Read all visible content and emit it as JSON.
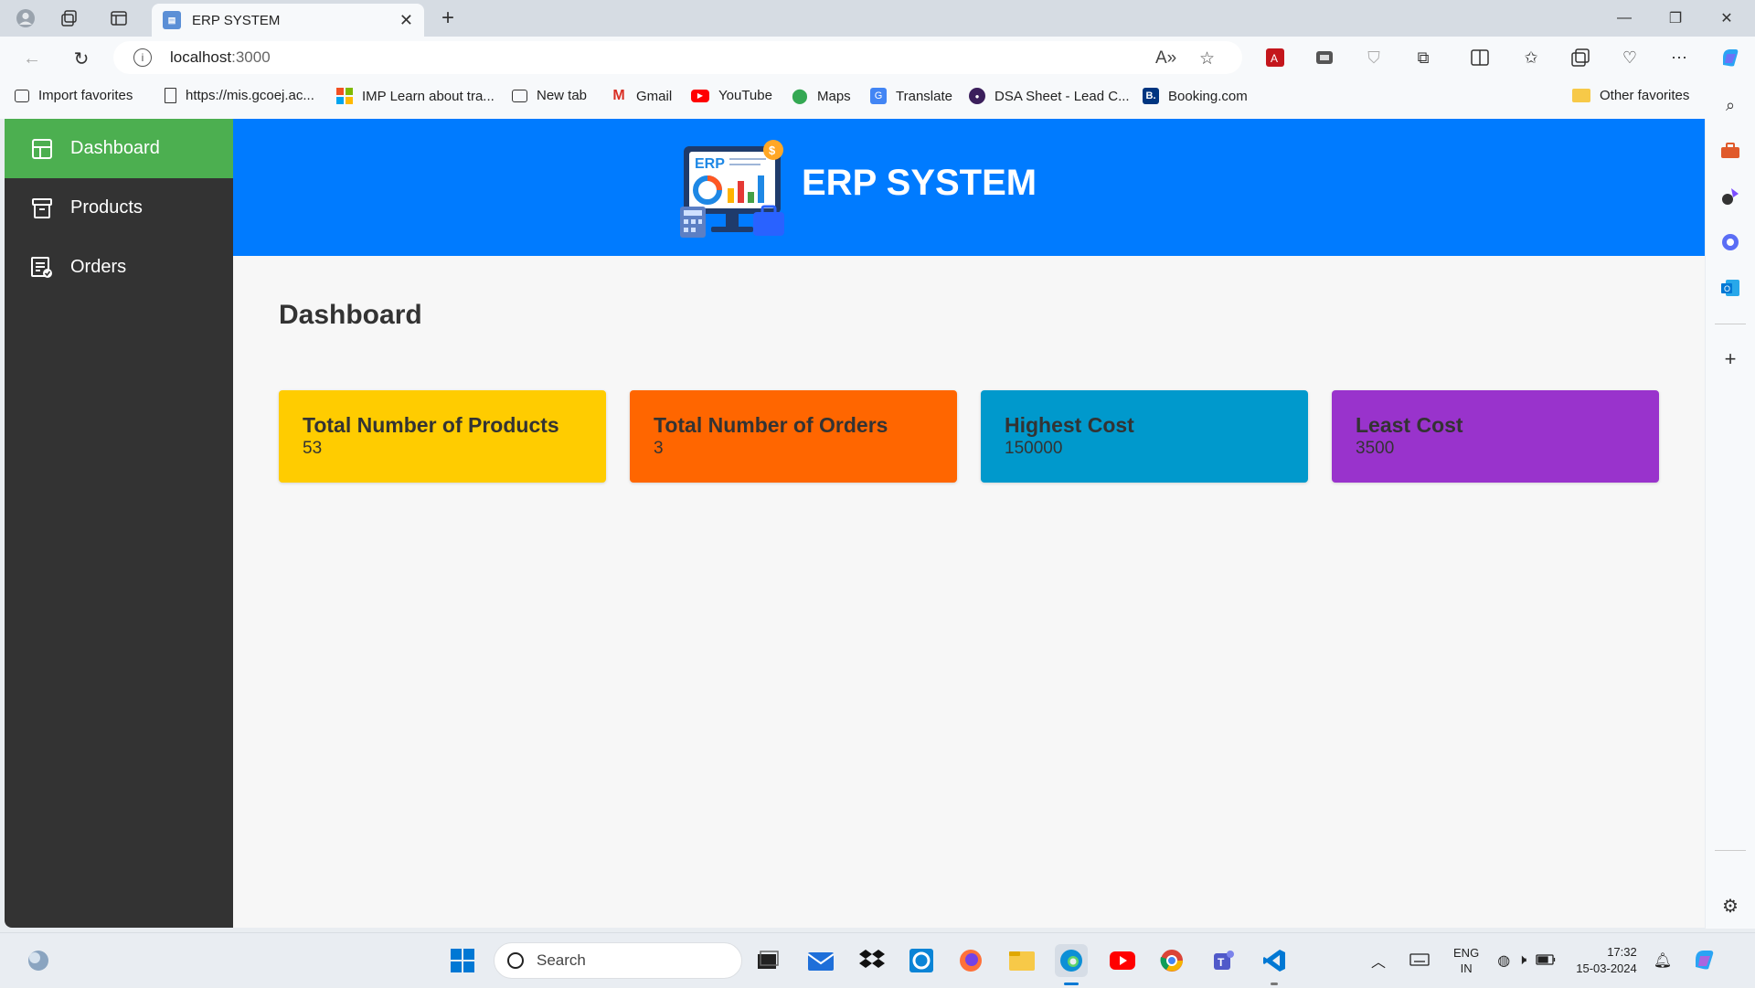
{
  "browser": {
    "tab_title": "ERP SYSTEM",
    "url_host": "localhost",
    "url_port": ":3000",
    "favorites": [
      {
        "label": "Import favorites",
        "icon": "import-icon"
      },
      {
        "label": "https://mis.gcoej.ac...",
        "icon": "page-icon"
      },
      {
        "label": "IMP Learn about tra...",
        "icon": "microsoft-icon"
      },
      {
        "label": "New tab",
        "icon": "newtab-icon"
      },
      {
        "label": "Gmail",
        "icon": "gmail-icon"
      },
      {
        "label": "YouTube",
        "icon": "youtube-icon"
      },
      {
        "label": "Maps",
        "icon": "maps-icon"
      },
      {
        "label": "Translate",
        "icon": "translate-icon"
      },
      {
        "label": "DSA Sheet - Lead C...",
        "icon": "dsa-icon"
      },
      {
        "label": "Booking.com",
        "icon": "booking-icon"
      }
    ],
    "other_favorites": "Other favorites"
  },
  "app": {
    "title": "ERP SYSTEM",
    "logo_text": "ERP",
    "sidebar": [
      {
        "label": "Dashboard",
        "icon": "dashboard-icon",
        "active": true
      },
      {
        "label": "Products",
        "icon": "archive-icon",
        "active": false
      },
      {
        "label": "Orders",
        "icon": "orders-icon",
        "active": false
      }
    ],
    "page_title": "Dashboard",
    "cards": [
      {
        "title": "Total Number of Products",
        "value": "53",
        "color": "#ffcc00"
      },
      {
        "title": "Total Number of Orders",
        "value": "3",
        "color": "#ff6600"
      },
      {
        "title": "Highest Cost",
        "value": "150000",
        "color": "#0099cc"
      },
      {
        "title": "Least Cost",
        "value": "3500",
        "color": "#9933cc"
      }
    ],
    "colors": {
      "header": "#007bff",
      "sidebar": "#333333",
      "sidebar_active": "#4caf50"
    }
  },
  "taskbar": {
    "search_placeholder": "Search",
    "lang_top": "ENG",
    "lang_bottom": "IN",
    "time": "17:32",
    "date": "15-03-2024"
  }
}
